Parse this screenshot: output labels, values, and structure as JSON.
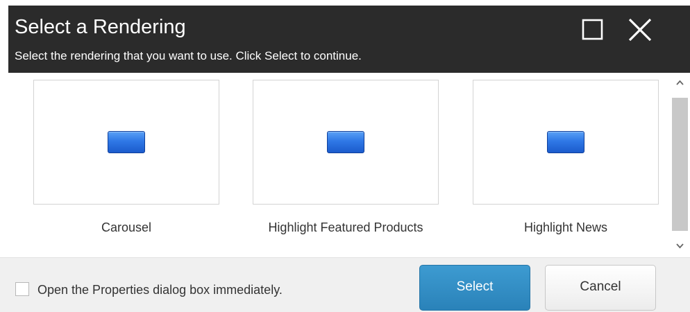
{
  "dialog": {
    "title": "Select a Rendering",
    "subtitle": "Select the rendering that you want to use. Click Select to continue."
  },
  "renderings": [
    {
      "label": "Carousel",
      "icon": "rendering-icon"
    },
    {
      "label": "Highlight Featured Products",
      "icon": "rendering-icon"
    },
    {
      "label": "Highlight News",
      "icon": "rendering-icon"
    }
  ],
  "footer": {
    "checkbox_label": "Open the Properties dialog box immediately.",
    "checkbox_checked": false,
    "select_label": "Select",
    "cancel_label": "Cancel"
  },
  "colors": {
    "titlebar": "#2b2b2b",
    "select_button": "#2a82b9",
    "icon_blue": "#2f78e6"
  }
}
